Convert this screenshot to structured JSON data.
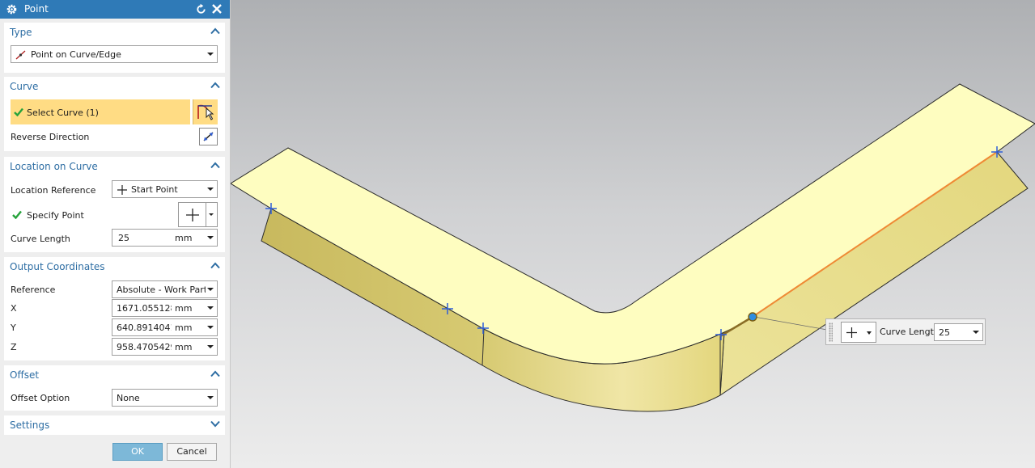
{
  "dialog": {
    "title": "Point",
    "icons": {
      "title": "gear-icon",
      "reset": "reset-icon",
      "close": "close-icon"
    },
    "type": {
      "header": "Type",
      "selected": "Point on Curve/Edge",
      "icon": "point-on-curve-icon"
    },
    "curve": {
      "header": "Curve",
      "select_label": "Select Curve (1)",
      "select_icon": "curve-select-icon",
      "reverse_label": "Reverse Direction",
      "reverse_icon": "reverse-direction-icon"
    },
    "location": {
      "header": "Location on Curve",
      "reference_label": "Location Reference",
      "reference_value": "Start Point",
      "specify_label": "Specify Point",
      "length_label": "Curve Length",
      "length_value": "25",
      "length_unit": "mm"
    },
    "output": {
      "header": "Output Coordinates",
      "reference_label": "Reference",
      "reference_value": "Absolute - Work Part",
      "x_label": "X",
      "x_value": "1671.0551281",
      "y_label": "Y",
      "y_value": "640.8914041",
      "z_label": "Z",
      "z_value": "958.4705429",
      "unit": "mm"
    },
    "offset": {
      "header": "Offset",
      "option_label": "Offset Option",
      "option_value": "None"
    },
    "settings": {
      "header": "Settings"
    },
    "ok_label": "OK",
    "cancel_label": "Cancel"
  },
  "viewport": {
    "floating_toolbar": {
      "length_label": "Curve Length",
      "length_value": "25",
      "point_icon": "cross-point-icon"
    }
  },
  "colors": {
    "title_bar": "#2f7ab7",
    "section_header": "#2d6da3",
    "selection_highlight": "#ffdc84",
    "surface_top": "#fefdc0",
    "surface_side": "#e5d97c",
    "selected_edge": "#ef8a35",
    "point_marker": "#2f5fd8",
    "ok_button": "#7db8d8"
  }
}
